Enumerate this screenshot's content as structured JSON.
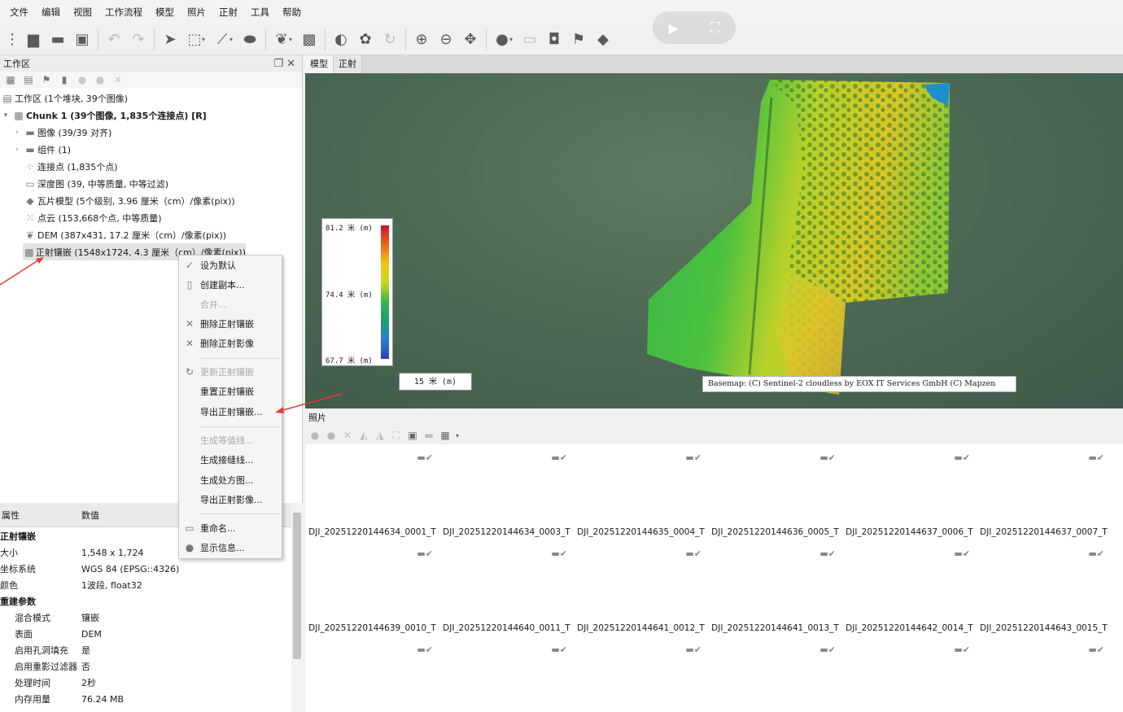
{
  "menu": [
    "文件",
    "编辑",
    "视图",
    "工作流程",
    "模型",
    "照片",
    "正射",
    "工具",
    "帮助"
  ],
  "workspace": {
    "title": "工作区",
    "root": "工作区 (1个堆块, 39个图像)",
    "chunk": "Chunk 1 (39个图像, 1,835个连接点) [R]",
    "items": [
      "图像 (39/39 对齐)",
      "组件 (1)",
      "连接点 (1,835个点)",
      "深度图 (39, 中等质量, 中等过滤)",
      "瓦片模型 (5个级别, 3.96 厘米（cm）/像素(pix))",
      "点云 (153,668个点, 中等质量)",
      "DEM (387x431, 17.2 厘米（cm）/像素(pix))",
      "正射镶嵌 (1548x1724, 4.3 厘米（cm）/像素(pix))"
    ]
  },
  "context_menu": {
    "set_default": "设为默认",
    "duplicate": "创建副本...",
    "merge": "合并...",
    "remove_ortho": "删除正射镶嵌",
    "remove_orthophotos": "删除正射影像",
    "update_ortho": "更新正射镶嵌",
    "reset_ortho": "重置正射镶嵌",
    "export_ortho": "导出正射镶嵌...",
    "gen_contours": "生成等值线...",
    "gen_seamlines": "生成接缝线...",
    "gen_prescription": "生成处方图...",
    "export_orthophotos": "导出正射影像...",
    "rename": "重命名...",
    "show_info": "显示信息..."
  },
  "properties": {
    "col_attr": "属性",
    "col_value": "数值",
    "section1": "正射镶嵌",
    "rows1": [
      {
        "k": "大小",
        "v": "1,548 x 1,724"
      },
      {
        "k": "坐标系统",
        "v": "WGS 84 (EPSG::4326)"
      },
      {
        "k": "颜色",
        "v": "1波段, float32"
      }
    ],
    "section2": "重建参数",
    "rows2": [
      {
        "k": "混合模式",
        "v": "镶嵌"
      },
      {
        "k": "表面",
        "v": "DEM"
      },
      {
        "k": "启用孔洞填充",
        "v": "是"
      },
      {
        "k": "启用重影过滤器",
        "v": "否"
      },
      {
        "k": "处理时间",
        "v": "2秒"
      },
      {
        "k": "内存用量",
        "v": "76.24 MB"
      }
    ]
  },
  "view": {
    "tabs": [
      "模型",
      "正射"
    ],
    "legend": {
      "max": "81.2 米 (m)",
      "mid": "74.4 米 (m)",
      "min": "67.7 米 (m)"
    },
    "scale": "15 米 (m)",
    "attribution": "Basemap: (C) Sentinel-2 cloudless by EOX IT Services GmbH (C) Mapzen"
  },
  "photos": {
    "title": "照片",
    "names_row1": [
      "DJI_20251220144634_0001_T",
      "DJI_20251220144634_0003_T",
      "DJI_20251220144635_0004_T",
      "DJI_20251220144636_0005_T",
      "DJI_20251220144637_0006_T",
      "DJI_20251220144637_0007_T"
    ],
    "names_row2": [
      "DJI_20251220144639_0010_T",
      "DJI_20251220144640_0011_T",
      "DJI_20251220144641_0012_T",
      "DJI_20251220144641_0013_T",
      "DJI_20251220144642_0014_T",
      "DJI_20251220144643_0015_T"
    ]
  }
}
